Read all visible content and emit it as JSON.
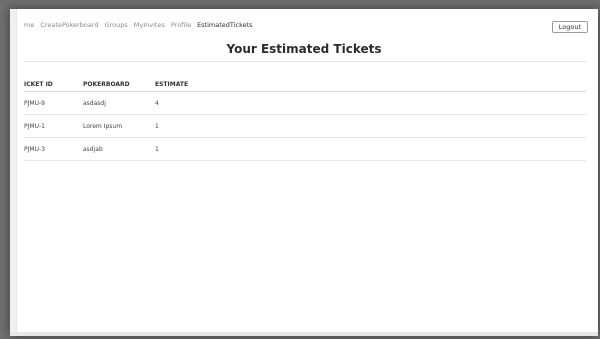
{
  "navbar": {
    "items": [
      {
        "label": "me"
      },
      {
        "label": "CreatePokerboard"
      },
      {
        "label": "Groups"
      },
      {
        "label": "MyInvites"
      },
      {
        "label": "Profile"
      },
      {
        "label": "EstimatedTickets"
      }
    ],
    "logout_label": "Logout"
  },
  "page": {
    "title": "Your Estimated Tickets"
  },
  "table": {
    "headers": [
      "ICKET ID",
      "POKERBOARD",
      "ESTIMATE"
    ],
    "rows": [
      {
        "ticket_id": "PJMU-9",
        "pokerboard": "asdasdj",
        "estimate": "4"
      },
      {
        "ticket_id": "PJMU-1",
        "pokerboard": "Lorem Ipsum",
        "estimate": "1"
      },
      {
        "ticket_id": "PJMU-3",
        "pokerboard": "asdjab",
        "estimate": "1"
      }
    ]
  },
  "colors": {
    "backdrop": "#6f6f6f",
    "surface": "#ffffff",
    "text_primary": "#2b2b2b",
    "text_muted": "#8a8a8a",
    "divider": "#e2e2e2"
  }
}
